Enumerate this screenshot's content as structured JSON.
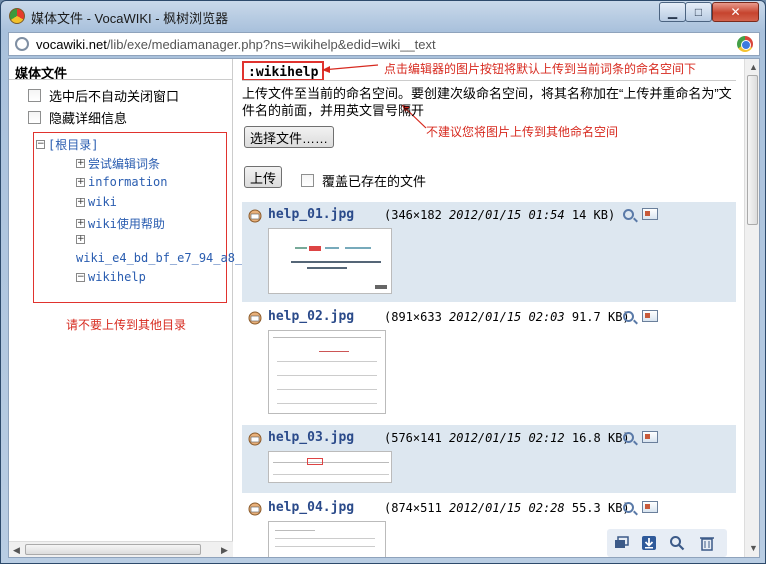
{
  "window": {
    "title": "媒体文件 - VocaWIKI - 枫树浏览器",
    "controls": {
      "minimize": "▁",
      "maximize": "□",
      "close": "✕"
    }
  },
  "address_bar": {
    "domain": "vocawiki.net",
    "path": "/lib/exe/mediamanager.php?ns=wikihelp&edid=wiki__text",
    "icons": [
      "globe-icon",
      "chrome-icon"
    ]
  },
  "sidebar": {
    "title": "媒体文件",
    "options": [
      {
        "label": "选中后不自动关闭窗口",
        "checked": false
      },
      {
        "label": "隐藏详细信息",
        "checked": false
      }
    ],
    "tree": {
      "root": "[根目录]",
      "items": [
        {
          "label": "尝试编辑词条",
          "toggle": "+"
        },
        {
          "label": "information",
          "toggle": "+"
        },
        {
          "label": "wiki",
          "toggle": "+"
        },
        {
          "label": "wiki使用帮助",
          "toggle": "+"
        },
        {
          "label": "wiki_e4_bd_bf_e7_94_a8_",
          "toggle": "+"
        },
        {
          "label": "wikihelp",
          "toggle": "−"
        }
      ]
    },
    "annotation": "请不要上传到其他目录"
  },
  "main": {
    "namespace": ":wikihelp",
    "description": "上传文件至当前的命名空间。要创建次级命名空间，将其名称加在“上传并重命名为”文件名的前面，并用英文冒号隔开",
    "choose_file_button": "选择文件……",
    "upload_button": "上传",
    "overwrite_label": "覆盖已存在的文件",
    "overwrite_checked": false,
    "annotation_namespace": "点击编辑器的图片按钮将默认上传到当前词条的命名空间下",
    "annotation_other": "不建议您将图片上传到其他命名空间",
    "media": [
      {
        "name": "help_01.jpg",
        "dims": "(346×182",
        "date": "2012/01/15 01:54",
        "size": "14 KB)"
      },
      {
        "name": "help_02.jpg",
        "dims": "(891×633",
        "date": "2012/01/15 02:03",
        "size": "91.7 KB)"
      },
      {
        "name": "help_03.jpg",
        "dims": "(576×141",
        "date": "2012/01/15 02:12",
        "size": "16.8 KB)"
      },
      {
        "name": "help_04.jpg",
        "dims": "(874×511",
        "date": "2012/01/15 02:28",
        "size": "55.3 KB)"
      }
    ],
    "toolbar_icons": [
      "window-icon",
      "download-icon",
      "zoom-icon",
      "trash-icon"
    ]
  },
  "colors": {
    "annotation_red": "#d72a1f",
    "shaded_row": "#dde7f0",
    "link_blue": "#2a4a8a"
  }
}
